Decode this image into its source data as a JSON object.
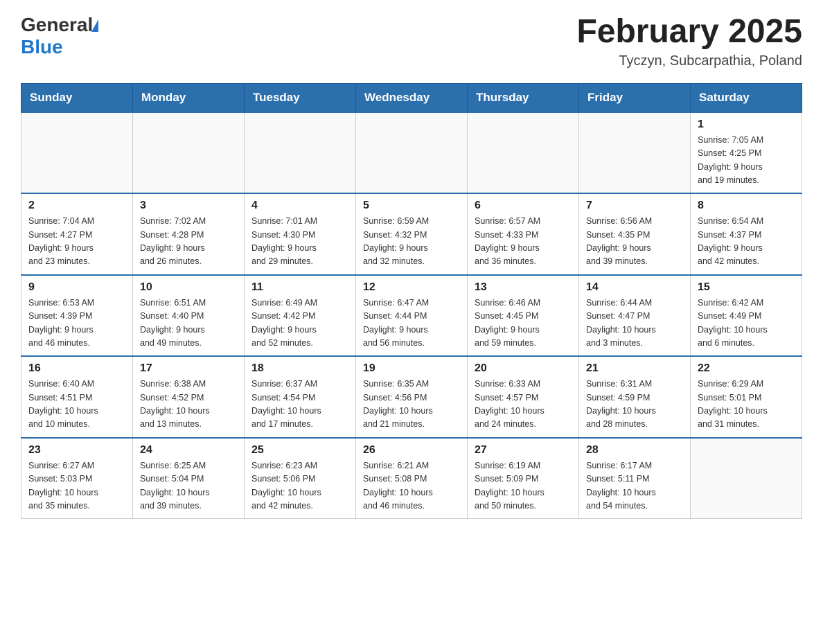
{
  "logo": {
    "general": "General",
    "blue": "Blue"
  },
  "title": "February 2025",
  "subtitle": "Tyczyn, Subcarpathia, Poland",
  "weekdays": [
    "Sunday",
    "Monday",
    "Tuesday",
    "Wednesday",
    "Thursday",
    "Friday",
    "Saturday"
  ],
  "weeks": [
    [
      {
        "day": "",
        "info": ""
      },
      {
        "day": "",
        "info": ""
      },
      {
        "day": "",
        "info": ""
      },
      {
        "day": "",
        "info": ""
      },
      {
        "day": "",
        "info": ""
      },
      {
        "day": "",
        "info": ""
      },
      {
        "day": "1",
        "info": "Sunrise: 7:05 AM\nSunset: 4:25 PM\nDaylight: 9 hours\nand 19 minutes."
      }
    ],
    [
      {
        "day": "2",
        "info": "Sunrise: 7:04 AM\nSunset: 4:27 PM\nDaylight: 9 hours\nand 23 minutes."
      },
      {
        "day": "3",
        "info": "Sunrise: 7:02 AM\nSunset: 4:28 PM\nDaylight: 9 hours\nand 26 minutes."
      },
      {
        "day": "4",
        "info": "Sunrise: 7:01 AM\nSunset: 4:30 PM\nDaylight: 9 hours\nand 29 minutes."
      },
      {
        "day": "5",
        "info": "Sunrise: 6:59 AM\nSunset: 4:32 PM\nDaylight: 9 hours\nand 32 minutes."
      },
      {
        "day": "6",
        "info": "Sunrise: 6:57 AM\nSunset: 4:33 PM\nDaylight: 9 hours\nand 36 minutes."
      },
      {
        "day": "7",
        "info": "Sunrise: 6:56 AM\nSunset: 4:35 PM\nDaylight: 9 hours\nand 39 minutes."
      },
      {
        "day": "8",
        "info": "Sunrise: 6:54 AM\nSunset: 4:37 PM\nDaylight: 9 hours\nand 42 minutes."
      }
    ],
    [
      {
        "day": "9",
        "info": "Sunrise: 6:53 AM\nSunset: 4:39 PM\nDaylight: 9 hours\nand 46 minutes."
      },
      {
        "day": "10",
        "info": "Sunrise: 6:51 AM\nSunset: 4:40 PM\nDaylight: 9 hours\nand 49 minutes."
      },
      {
        "day": "11",
        "info": "Sunrise: 6:49 AM\nSunset: 4:42 PM\nDaylight: 9 hours\nand 52 minutes."
      },
      {
        "day": "12",
        "info": "Sunrise: 6:47 AM\nSunset: 4:44 PM\nDaylight: 9 hours\nand 56 minutes."
      },
      {
        "day": "13",
        "info": "Sunrise: 6:46 AM\nSunset: 4:45 PM\nDaylight: 9 hours\nand 59 minutes."
      },
      {
        "day": "14",
        "info": "Sunrise: 6:44 AM\nSunset: 4:47 PM\nDaylight: 10 hours\nand 3 minutes."
      },
      {
        "day": "15",
        "info": "Sunrise: 6:42 AM\nSunset: 4:49 PM\nDaylight: 10 hours\nand 6 minutes."
      }
    ],
    [
      {
        "day": "16",
        "info": "Sunrise: 6:40 AM\nSunset: 4:51 PM\nDaylight: 10 hours\nand 10 minutes."
      },
      {
        "day": "17",
        "info": "Sunrise: 6:38 AM\nSunset: 4:52 PM\nDaylight: 10 hours\nand 13 minutes."
      },
      {
        "day": "18",
        "info": "Sunrise: 6:37 AM\nSunset: 4:54 PM\nDaylight: 10 hours\nand 17 minutes."
      },
      {
        "day": "19",
        "info": "Sunrise: 6:35 AM\nSunset: 4:56 PM\nDaylight: 10 hours\nand 21 minutes."
      },
      {
        "day": "20",
        "info": "Sunrise: 6:33 AM\nSunset: 4:57 PM\nDaylight: 10 hours\nand 24 minutes."
      },
      {
        "day": "21",
        "info": "Sunrise: 6:31 AM\nSunset: 4:59 PM\nDaylight: 10 hours\nand 28 minutes."
      },
      {
        "day": "22",
        "info": "Sunrise: 6:29 AM\nSunset: 5:01 PM\nDaylight: 10 hours\nand 31 minutes."
      }
    ],
    [
      {
        "day": "23",
        "info": "Sunrise: 6:27 AM\nSunset: 5:03 PM\nDaylight: 10 hours\nand 35 minutes."
      },
      {
        "day": "24",
        "info": "Sunrise: 6:25 AM\nSunset: 5:04 PM\nDaylight: 10 hours\nand 39 minutes."
      },
      {
        "day": "25",
        "info": "Sunrise: 6:23 AM\nSunset: 5:06 PM\nDaylight: 10 hours\nand 42 minutes."
      },
      {
        "day": "26",
        "info": "Sunrise: 6:21 AM\nSunset: 5:08 PM\nDaylight: 10 hours\nand 46 minutes."
      },
      {
        "day": "27",
        "info": "Sunrise: 6:19 AM\nSunset: 5:09 PM\nDaylight: 10 hours\nand 50 minutes."
      },
      {
        "day": "28",
        "info": "Sunrise: 6:17 AM\nSunset: 5:11 PM\nDaylight: 10 hours\nand 54 minutes."
      },
      {
        "day": "",
        "info": ""
      }
    ]
  ]
}
